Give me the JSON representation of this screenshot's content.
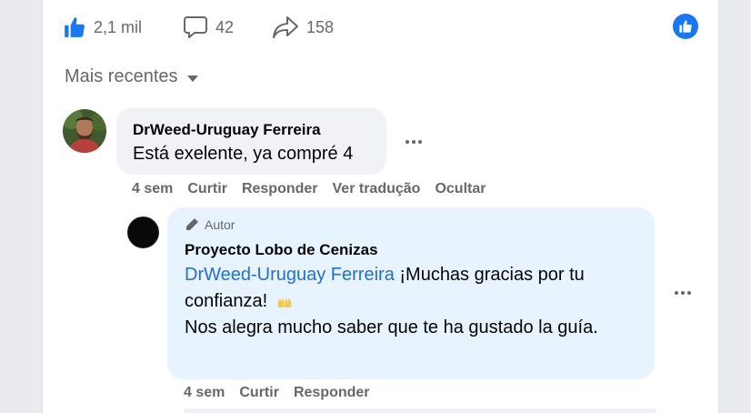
{
  "stats": {
    "likes": "2,1 mil",
    "comments": "42",
    "shares": "158"
  },
  "sort": {
    "label": "Mais recentes"
  },
  "comment": {
    "author": "DrWeed-Uruguay Ferreira",
    "text": "Está exelente, ya compré 4",
    "time": "4 sem",
    "actions": {
      "like": "Curtir",
      "reply": "Responder",
      "translate": "Ver tradução",
      "hide": "Ocultar"
    }
  },
  "reply": {
    "badge": "Autor",
    "author": "Proyecto Lobo de Cenizas",
    "mention": "DrWeed-Uruguay Ferreira",
    "text_line1": " ¡Muchas gracias por tu confianza!",
    "text_line2": "Nos alegra mucho saber que te ha gustado la guía.",
    "time": "4 sem",
    "actions": {
      "like": "Curtir",
      "reply": "Responder"
    }
  },
  "colors": {
    "accent": "#1877f2",
    "mention": "#216fdb",
    "bubble": "#f0f2f5",
    "author_bubble": "#e7f3ff"
  },
  "icons": [
    "thumbs-up-icon",
    "comment-icon",
    "share-icon",
    "like-badge-icon",
    "caret-down-icon",
    "more-icon",
    "pen-icon",
    "raised-hands-emoji"
  ]
}
